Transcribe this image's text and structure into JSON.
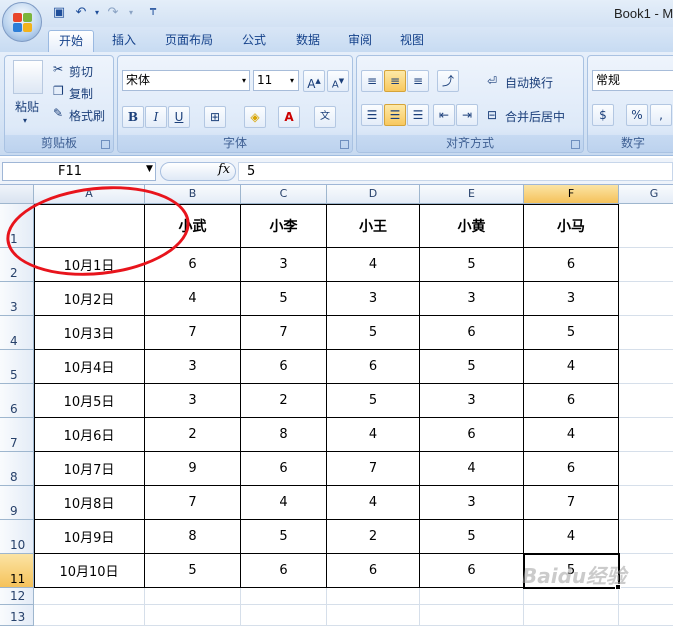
{
  "window": {
    "title": "Book1 - M"
  },
  "tabs": [
    {
      "label": "开始",
      "active": true
    },
    {
      "label": "插入"
    },
    {
      "label": "页面布局"
    },
    {
      "label": "公式"
    },
    {
      "label": "数据"
    },
    {
      "label": "审阅"
    },
    {
      "label": "视图"
    }
  ],
  "ribbon": {
    "clipboard": {
      "label": "剪贴板",
      "paste": "粘贴",
      "cut": "剪切",
      "copy": "复制",
      "format_painter": "格式刷"
    },
    "font": {
      "label": "字体",
      "font_name": "宋体",
      "font_size": "11"
    },
    "alignment": {
      "label": "对齐方式",
      "wrap_text": "自动换行",
      "merge_center": "合并后居中"
    },
    "number": {
      "label": "数字",
      "format": "常规",
      "percent": "%",
      "comma": ","
    }
  },
  "formula_bar": {
    "name_box": "F11",
    "fx": "fx",
    "value": "5"
  },
  "sheet": {
    "columns": [
      "A",
      "B",
      "C",
      "D",
      "E",
      "F",
      "G"
    ],
    "rows": [
      "1",
      "2",
      "3",
      "4",
      "5",
      "6",
      "7",
      "8",
      "9",
      "10",
      "11",
      "12",
      "13"
    ],
    "headers": [
      "",
      "小武",
      "小李",
      "小王",
      "小黄",
      "小马"
    ],
    "data": [
      [
        "10月1日",
        "6",
        "3",
        "4",
        "5",
        "6"
      ],
      [
        "10月2日",
        "4",
        "5",
        "3",
        "3",
        "3"
      ],
      [
        "10月3日",
        "7",
        "7",
        "5",
        "6",
        "5"
      ],
      [
        "10月4日",
        "3",
        "6",
        "6",
        "5",
        "4"
      ],
      [
        "10月5日",
        "3",
        "2",
        "5",
        "3",
        "6"
      ],
      [
        "10月6日",
        "2",
        "8",
        "4",
        "6",
        "4"
      ],
      [
        "10月7日",
        "9",
        "6",
        "7",
        "4",
        "6"
      ],
      [
        "10月8日",
        "7",
        "4",
        "4",
        "3",
        "7"
      ],
      [
        "10月9日",
        "8",
        "5",
        "2",
        "5",
        "4"
      ],
      [
        "10月10日",
        "5",
        "6",
        "6",
        "6",
        "5"
      ]
    ]
  },
  "watermark": "Baidu经验"
}
